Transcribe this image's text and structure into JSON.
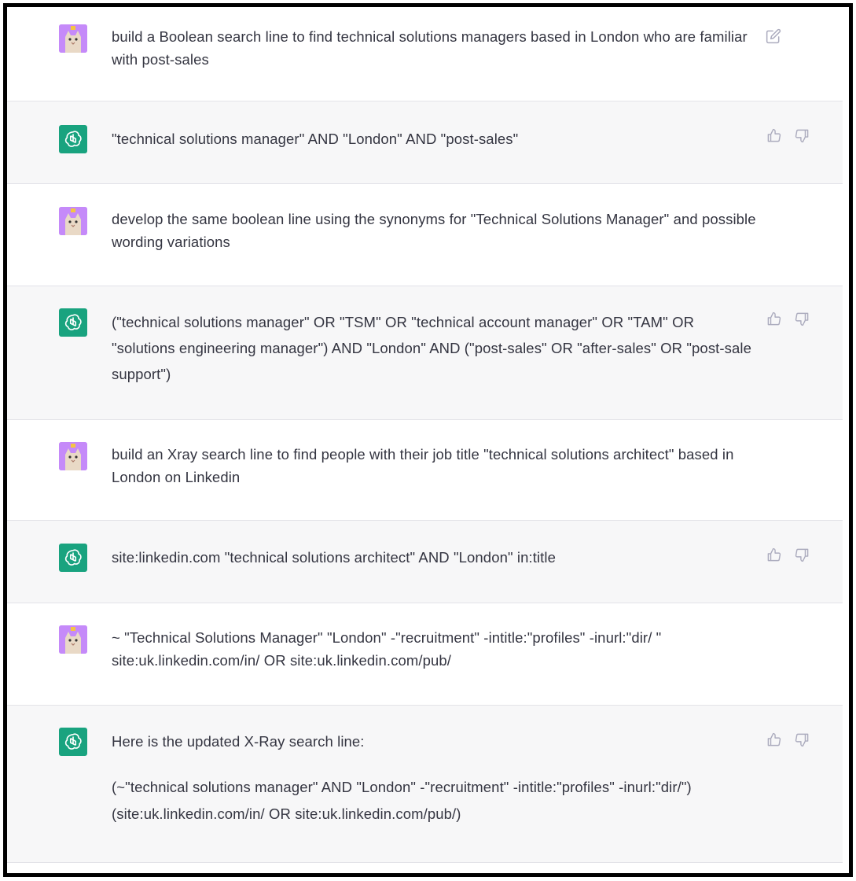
{
  "messages": [
    {
      "role": "user",
      "text": "build a Boolean search line to find technical solutions managers based in London who are familiar with post-sales",
      "action": "edit-icon"
    },
    {
      "role": "assistant",
      "text": "\"technical solutions manager\" AND \"London\" AND \"post-sales\"",
      "actions": [
        "thumbs-up-icon",
        "thumbs-down-icon"
      ]
    },
    {
      "role": "user",
      "text": "develop the same boolean line using the synonyms for \"Technical Solutions Manager\" and possible wording variations"
    },
    {
      "role": "assistant",
      "text": "(\"technical solutions manager\" OR \"TSM\" OR \"technical account manager\" OR \"TAM\" OR \"solutions engineering manager\") AND \"London\" AND (\"post-sales\" OR \"after-sales\" OR \"post-sale support\")",
      "actions": [
        "thumbs-up-icon",
        "thumbs-down-icon"
      ]
    },
    {
      "role": "user",
      "text": "build an Xray search line to find people with their job title \"technical solutions architect\" based in London on Linkedin"
    },
    {
      "role": "assistant",
      "text": "site:linkedin.com \"technical solutions architect\" AND \"London\" in:title",
      "actions": [
        "thumbs-up-icon",
        "thumbs-down-icon"
      ]
    },
    {
      "role": "user",
      "text": "~ \"Technical Solutions Manager\" \"London\" -\"recruitment\" -intitle:\"profiles\" -inurl:\"dir/ \" site:uk.linkedin.com/in/ OR site:uk.linkedin.com/pub/"
    },
    {
      "role": "assistant",
      "text": "Here is the updated X-Ray search line:",
      "text2": "(~\"technical solutions manager\" AND \"London\" -\"recruitment\" -intitle:\"profiles\" -inurl:\"dir/\") (site:uk.linkedin.com/in/ OR site:uk.linkedin.com/pub/)",
      "actions": [
        "thumbs-up-icon",
        "thumbs-down-icon"
      ]
    }
  ],
  "colors": {
    "assistant_bg": "#f7f7f8",
    "bot_avatar": "#19a37f",
    "user_avatar": "#c58af9",
    "text": "#343541",
    "icon": "#acacbe"
  }
}
